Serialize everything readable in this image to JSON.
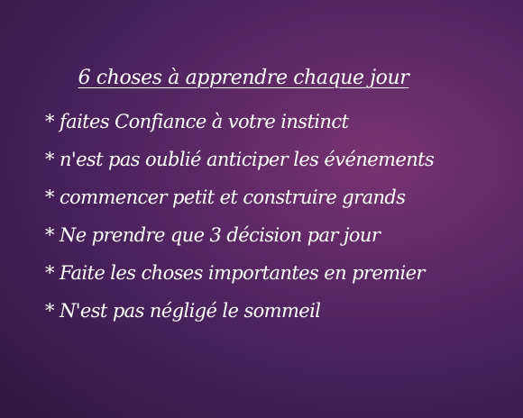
{
  "title": "6 choses à apprendre chaque jour",
  "items": [
    "* faites Confiance à votre instinct",
    "* n'est pas oublié anticiper les événements",
    "* commencer petit et construire grands",
    "* Ne prendre que 3 décision par jour",
    "* Faite les choses importantes en premier",
    "* N'est pas négligé le sommeil"
  ],
  "colors": {
    "background_center": "#7a3472",
    "background_edge": "#2f1840",
    "text": "#ffffff"
  }
}
